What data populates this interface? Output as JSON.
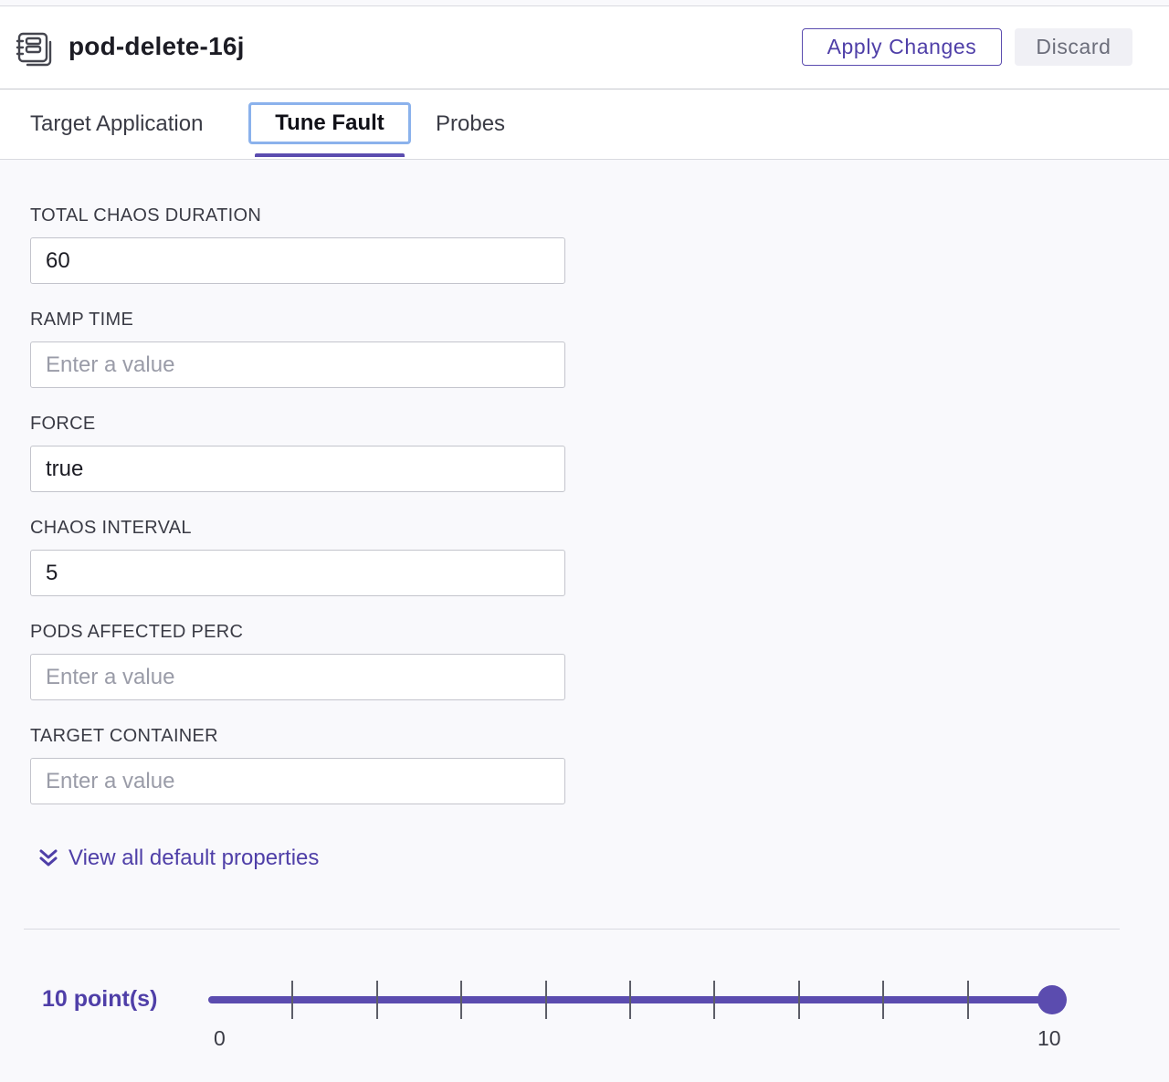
{
  "header": {
    "title": "pod-delete-16j",
    "icon": "fault-icon",
    "apply_label": "Apply Changes",
    "discard_label": "Discard"
  },
  "tabs": [
    {
      "label": "Target Application",
      "active": false
    },
    {
      "label": "Tune Fault",
      "active": true
    },
    {
      "label": "Probes",
      "active": false
    }
  ],
  "fields": [
    {
      "label": "TOTAL CHAOS DURATION",
      "value": "60",
      "placeholder": "Enter a value"
    },
    {
      "label": "RAMP TIME",
      "value": "",
      "placeholder": "Enter a value"
    },
    {
      "label": "FORCE",
      "value": "true",
      "placeholder": "Enter a value"
    },
    {
      "label": "CHAOS INTERVAL",
      "value": "5",
      "placeholder": "Enter a value"
    },
    {
      "label": "PODS AFFECTED PERC",
      "value": "",
      "placeholder": "Enter a value"
    },
    {
      "label": "TARGET CONTAINER",
      "value": "",
      "placeholder": "Enter a value"
    }
  ],
  "view_all": {
    "label": "View all default properties",
    "icon": "double-chevron-down-icon"
  },
  "weight": {
    "label": "10 point(s)",
    "min": 0,
    "max": 10,
    "value": 10,
    "min_label": "0",
    "max_label": "10"
  },
  "colors": {
    "accent": "#5b4caf",
    "focus_ring": "#8bb2ec",
    "background": "#f9f9fc"
  }
}
